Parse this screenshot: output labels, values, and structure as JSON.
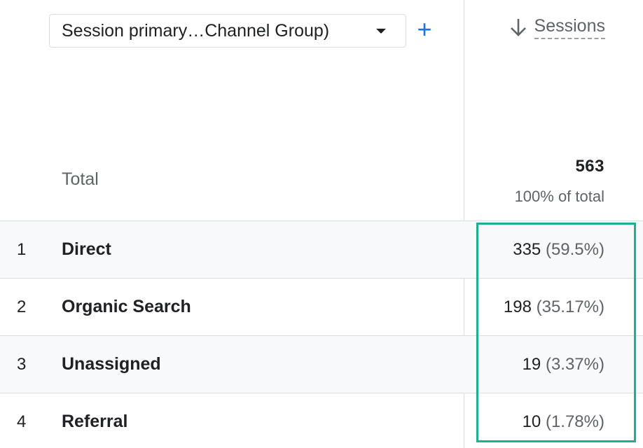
{
  "header": {
    "dimension_label": "Session primary…Channel Group)",
    "add_dimension_symbol": "+",
    "metric_title": "Sessions"
  },
  "totals": {
    "label": "Total",
    "value": "563",
    "percent_label": "100% of total"
  },
  "rows": [
    {
      "index": "1",
      "name": "Direct",
      "value": "335",
      "percent": "(59.5%)"
    },
    {
      "index": "2",
      "name": "Organic Search",
      "value": "198",
      "percent": "(35.17%)"
    },
    {
      "index": "3",
      "name": "Unassigned",
      "value": "19",
      "percent": "(3.37%)"
    },
    {
      "index": "4",
      "name": "Referral",
      "value": "10",
      "percent": "(1.78%)"
    }
  ],
  "colors": {
    "accent": "#1a73e8",
    "highlight": "#1bb08f"
  },
  "icons": {
    "sort": "arrow-down-icon",
    "dropdown": "chevron-down-icon",
    "add": "plus-icon"
  }
}
